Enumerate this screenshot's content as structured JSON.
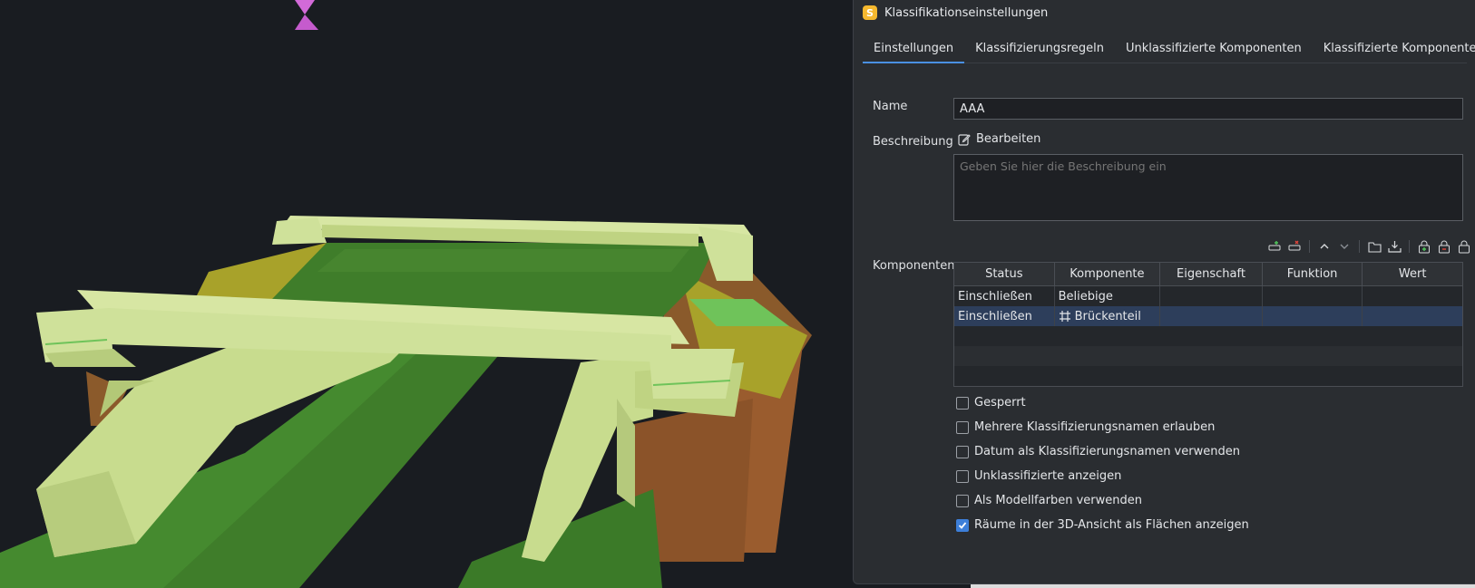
{
  "dialog": {
    "title": "Klassifikationseinstellungen",
    "app_icon_letter": "S",
    "tabs": [
      {
        "label": "Einstellungen",
        "active": true
      },
      {
        "label": "Klassifizierungsregeln",
        "active": false
      },
      {
        "label": "Unklassifizierte Komponenten",
        "active": false
      },
      {
        "label": "Klassifizierte Komponenten",
        "active": false
      }
    ],
    "name_label": "Name",
    "name_value": "AAA",
    "description_label": "Beschreibung",
    "edit_label": "Bearbeiten",
    "description_placeholder": "Geben Sie hier die Beschreibung ein",
    "components_label": "Komponenten",
    "toolbar_icons": [
      "add-row-icon",
      "remove-row-icon",
      "move-up-icon",
      "move-down-icon",
      "open-folder-icon",
      "import-icon",
      "lock-add-icon",
      "lock-remove-icon",
      "lock-icon"
    ],
    "table": {
      "headers": [
        "Status",
        "Komponente",
        "Eigenschaft",
        "Funktion",
        "Wert"
      ],
      "rows": [
        {
          "status": "Einschließen",
          "component": "Beliebige",
          "property": "",
          "function": "",
          "value": "",
          "icon": null
        },
        {
          "status": "Einschließen",
          "component": "Brückenteil",
          "property": "",
          "function": "",
          "value": "",
          "icon": "bridge-part-icon",
          "selected": true
        }
      ]
    },
    "options": [
      {
        "label": "Gesperrt",
        "checked": false
      },
      {
        "label": "Mehrere Klassifizierungsnamen erlauben",
        "checked": false
      },
      {
        "label": "Datum als Klassifizierungsnamen verwenden",
        "checked": false
      },
      {
        "label": "Unklassifizierte anzeigen",
        "checked": false
      },
      {
        "label": "Als Modellfarben verwenden",
        "checked": false
      },
      {
        "label": "Räume in der 3D-Ansicht als Flächen anzeigen",
        "checked": true
      }
    ]
  },
  "colors": {
    "accent": "#4a90e2",
    "selected_row": "#2d3e5b",
    "viewport_bg": "#191c21",
    "bridge_light": "#cfe19a",
    "grass": "#3f7d2a",
    "earth": "#9a5c2e"
  }
}
